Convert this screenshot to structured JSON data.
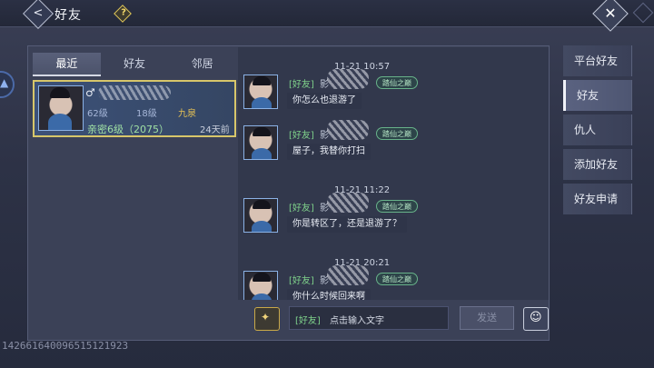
{
  "header": {
    "title": "好友",
    "help_icon": "question-icon",
    "close_icon": "close-icon",
    "back_icon": "back-arrow-icon"
  },
  "tabs": [
    {
      "label": "最近",
      "active": true
    },
    {
      "label": "好友",
      "active": false
    },
    {
      "label": "邻居",
      "active": false
    }
  ],
  "friend_card": {
    "level": "62级",
    "level2": "18级",
    "server": "九泉",
    "intimacy": "亲密6级（2075）",
    "last_seen": "24天前"
  },
  "messages": [
    {
      "time": "11-21 10:57",
      "tag": "[好友]",
      "name": "影",
      "badge": "踏仙之巅",
      "text": "你怎么也退游了"
    },
    {
      "time": "",
      "tag": "[好友]",
      "name": "影",
      "badge": "踏仙之巅",
      "text": "屋子，我替你打扫"
    },
    {
      "time": "11-21 11:22",
      "tag": "[好友]",
      "name": "影",
      "badge": "踏仙之巅",
      "text": "你是转区了，还是退游了？"
    },
    {
      "time": "11-21 20:21",
      "tag": "[好友]",
      "name": "影",
      "badge": "踏仙之巅",
      "text": "你什么时候回来啊"
    }
  ],
  "input": {
    "tag": "[好友]",
    "placeholder": "点击输入文字",
    "send_label": "发送"
  },
  "right_menu": [
    {
      "label": "平台好友",
      "active": false
    },
    {
      "label": "好友",
      "active": true
    },
    {
      "label": "仇人",
      "active": false
    },
    {
      "label": "添加好友",
      "active": false
    },
    {
      "label": "好友申请",
      "active": false
    }
  ],
  "uid": "142661640096515121923"
}
